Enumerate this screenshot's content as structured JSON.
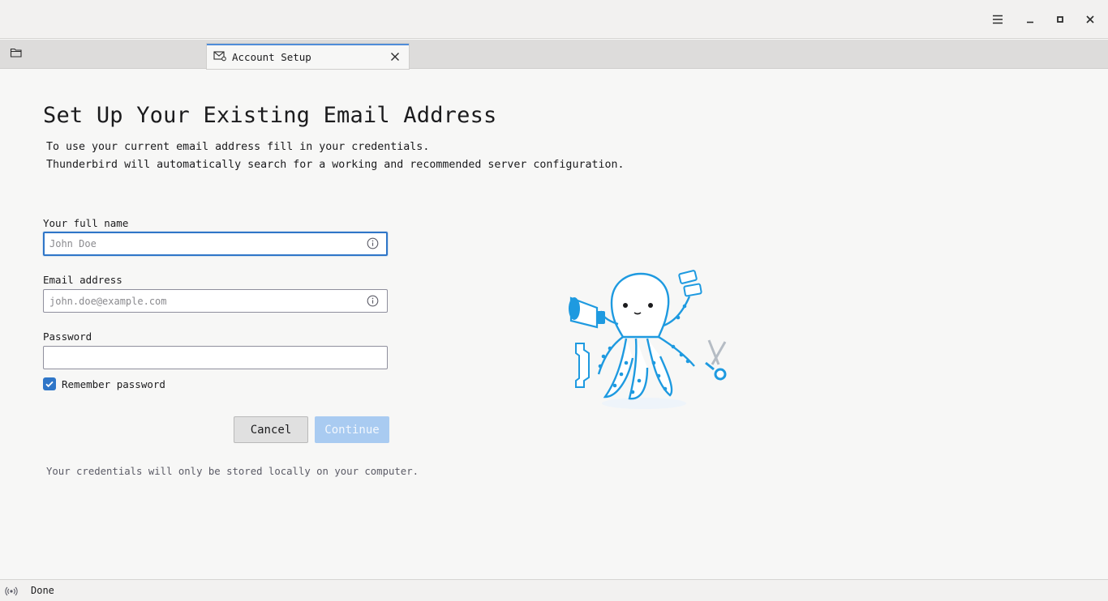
{
  "window": {
    "controls": [
      "menu-icon",
      "minimize-icon",
      "maximize-icon",
      "close-icon"
    ]
  },
  "tabs": [
    {
      "icon": "folder-icon",
      "label": ""
    },
    {
      "icon": "mail-setup-icon",
      "label": "Account Setup",
      "active": true
    }
  ],
  "main": {
    "title": "Set Up Your Existing Email Address",
    "description_line1": "To use your current email address fill in your credentials.",
    "description_line2": "Thunderbird will automatically search for a working and recommended server configuration.",
    "fullname": {
      "label": "Your full name",
      "value": "",
      "placeholder": "John Doe"
    },
    "email": {
      "label": "Email address",
      "value": "",
      "placeholder": "john.doe@example.com"
    },
    "password": {
      "label": "Password",
      "value": "",
      "placeholder": ""
    },
    "remember_password": {
      "label": "Remember password",
      "checked": true
    },
    "cancel_label": "Cancel",
    "continue_label": "Continue",
    "footnote": "Your credentials will only be stored locally on your computer.",
    "illustration": "octopus-illustration"
  },
  "colors": {
    "accent": "#2f76c8",
    "tab_highlight": "#4f8cd8",
    "continue_disabled": "#a9cbf1",
    "illustration_blue": "#1e9ae0"
  },
  "statusbar": {
    "icon": "activity-icon",
    "text": "Done"
  }
}
